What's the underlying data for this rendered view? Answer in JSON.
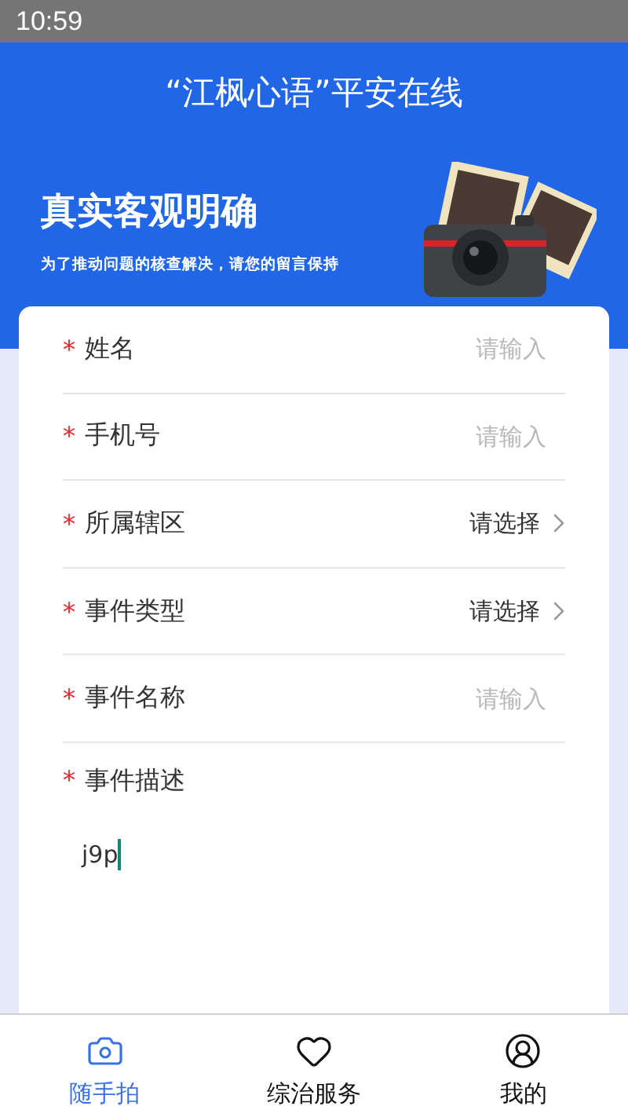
{
  "status_bar": {
    "time": "10:59"
  },
  "header": {
    "title": "“江枫心语”平安在线"
  },
  "banner": {
    "headline": "真实客观明确",
    "subtitle": "为了推动问题的核查解决，请您的留言保持"
  },
  "form": {
    "fields": [
      {
        "kind": "input",
        "label": "姓名",
        "required_mark": "*",
        "placeholder": "请输入"
      },
      {
        "kind": "input",
        "label": "手机号",
        "required_mark": "*",
        "placeholder": "请输入"
      },
      {
        "kind": "select",
        "label": "所属辖区",
        "required_mark": "*",
        "value": "请选择"
      },
      {
        "kind": "select",
        "label": "事件类型",
        "required_mark": "*",
        "value": "请选择"
      },
      {
        "kind": "input",
        "label": "事件名称",
        "required_mark": "*",
        "placeholder": "请输入"
      }
    ],
    "description": {
      "label": "事件描述",
      "required_mark": "*",
      "value": "j9p"
    }
  },
  "bottom_nav": [
    {
      "label": "随手拍",
      "selected": true
    },
    {
      "label": "综治服务",
      "selected": false
    },
    {
      "label": "我的",
      "selected": false
    }
  ]
}
